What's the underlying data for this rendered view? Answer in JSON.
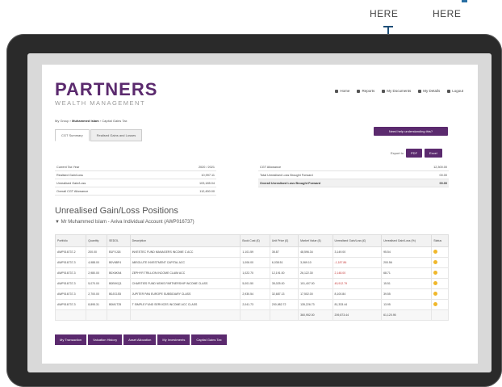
{
  "callouts": {
    "left": "HERE",
    "right": "HERE"
  },
  "colors": {
    "brand": "#5b2a6e",
    "pointer": "#1f4f78",
    "loss": "#c63b3b",
    "badge": "#f0b72a"
  },
  "logo": {
    "line1": "PARTNERS",
    "line2": "WEALTH MANAGEMENT"
  },
  "topnav": [
    {
      "icon": "home-icon",
      "label": "Home"
    },
    {
      "icon": "reports-icon",
      "label": "Reports"
    },
    {
      "icon": "documents-icon",
      "label": "My Documents"
    },
    {
      "icon": "details-icon",
      "label": "My Details"
    },
    {
      "icon": "logout-icon",
      "label": "Logout"
    }
  ],
  "breadcrumb": {
    "root": "My Group",
    "current": "Muhammed Islam",
    "trail": "Capital Gains Tax"
  },
  "tabs": [
    "CGT Summary",
    "Realised Gains and Losses"
  ],
  "cta_label": "Need help understanding this?",
  "export": {
    "label": "Export to",
    "pdf": "PDF",
    "excel": "Excel"
  },
  "summary_left": [
    {
      "label": "Current Tax Year",
      "value": "2020 / 2021"
    },
    {
      "label": "Realised Gain/Loss",
      "value": "10,997.11"
    },
    {
      "label": "Unrealised Gain/Loss",
      "value": "103,185.04"
    },
    {
      "label": "Overall CGT Allowance",
      "value": "112,450.00"
    }
  ],
  "summary_right": [
    {
      "label": "CGT Allowance",
      "value": "12,300.00"
    },
    {
      "label": "Total Unrealised Loss Brought Forward",
      "value": "00.00"
    },
    {
      "label": "Overall Unrealised Loss Brought Forward",
      "value": "00.00"
    }
  ],
  "section_title": "Unrealised Gain/Loss Positions",
  "account_title": "Mr Muhammed Islam - Aviva Individual Account (AWP016737)",
  "table": {
    "headers": [
      "Portfolio",
      "Quantity",
      "SEDOL",
      "Description",
      "Book Cost (£)",
      "Unit Price (£)",
      "Market Value (£)",
      "Unrealised Gain/Loss (£)",
      "Unrealised Gain/Loss (%)",
      "Status"
    ],
    "rows": [
      [
        "AWP016737-2",
        "200.00",
        "B1FXJ18",
        "INVESTEC FUND MANAGERS INCOME C ACC",
        "1.101.59",
        "35.87",
        "48,596.34",
        "3,149.00",
        "95.54",
        "warning"
      ],
      [
        "AWP016737-3",
        "4,988.00",
        "B0V6BF4",
        "ABSOLUTE INVESTMENT CAPITAL ACC",
        "1,006.00",
        "6,038.51",
        "3,069.10",
        "-1,187.86",
        "200.56",
        "warning"
      ],
      [
        "AWP016737-3",
        "2,980.00",
        "B0X6KN4",
        "ZEPHYR TRILLION INCOME CLAIM ACC",
        "1,022.70",
        "12,191.00",
        "26,122.30",
        "2,148.00",
        "68.71",
        "warning"
      ],
      [
        "AWP016737-3",
        "5,070.00",
        "B0B9XQ1",
        "CHARITIES FUND NEWS PARTNERSHIP INCOME CLASS",
        "5,001.50",
        "35,025.00",
        "101,407.00",
        "45,912.79",
        "15.51",
        "warning"
      ],
      [
        "AWP016737-3",
        "2,700.00",
        "B0JG1S5",
        "JUPITER PAN EUROPE SUBSIDIARY CLASS",
        "2,930.54",
        "32,687.13",
        "17,502.00",
        "8,100.84",
        "39.55",
        "warning"
      ],
      [
        "AWP016737-3",
        "8,895.31",
        "B0M1T25",
        "T SIMPLE FUND SERVICES INCOME ACC CLASS",
        "2,041.73",
        "200,982.72",
        "135,226.73",
        "81,333.44",
        "13.95",
        "warning"
      ]
    ],
    "total": [
      "",
      "",
      "",
      "",
      "",
      "",
      "360,952.00",
      "209,873.44",
      "61,120.95",
      "",
      ""
    ]
  },
  "bottom_buttons": [
    "My Transaction",
    "Valuation History",
    "Asset Allocation",
    "My Investments",
    "Capital Gains Tax"
  ]
}
